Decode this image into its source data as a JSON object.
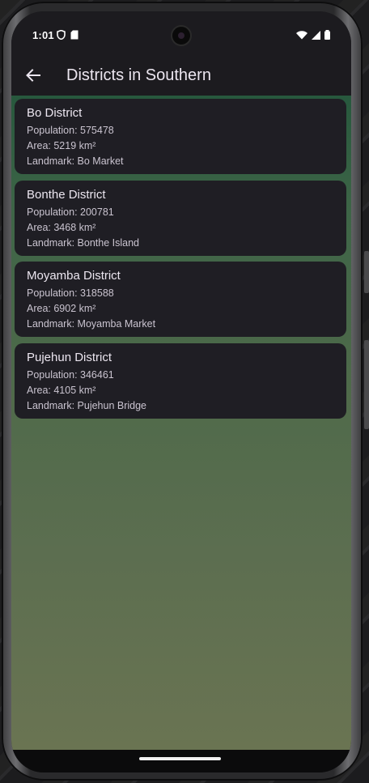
{
  "status_bar": {
    "time": "1:01",
    "left_icons": [
      "sd-card-icon",
      "shield-icon"
    ],
    "right_icons": [
      "wifi-icon",
      "cell-signal-icon",
      "battery-icon"
    ]
  },
  "app_bar": {
    "title": "Districts in Southern",
    "back_icon": "arrow-left-icon"
  },
  "districts": [
    {
      "name": "Bo District",
      "population": "Population: 575478",
      "area": "Area: 5219 km²",
      "landmark": "Landmark: Bo Market"
    },
    {
      "name": "Bonthe District",
      "population": "Population: 200781",
      "area": "Area: 3468 km²",
      "landmark": "Landmark: Bonthe Island"
    },
    {
      "name": "Moyamba District",
      "population": "Population: 318588",
      "area": "Area: 6902 km²",
      "landmark": "Landmark: Moyamba Market"
    },
    {
      "name": "Pujehun District",
      "population": "Population: 346461",
      "area": "Area: 4105 km²",
      "landmark": "Landmark: Pujehun Bridge"
    }
  ],
  "colors": {
    "app_bar_bg": "#1c1b1f",
    "card_bg": "#1f1e24",
    "content_gradient_top": "#27583d",
    "content_gradient_bottom": "#6a7452"
  }
}
